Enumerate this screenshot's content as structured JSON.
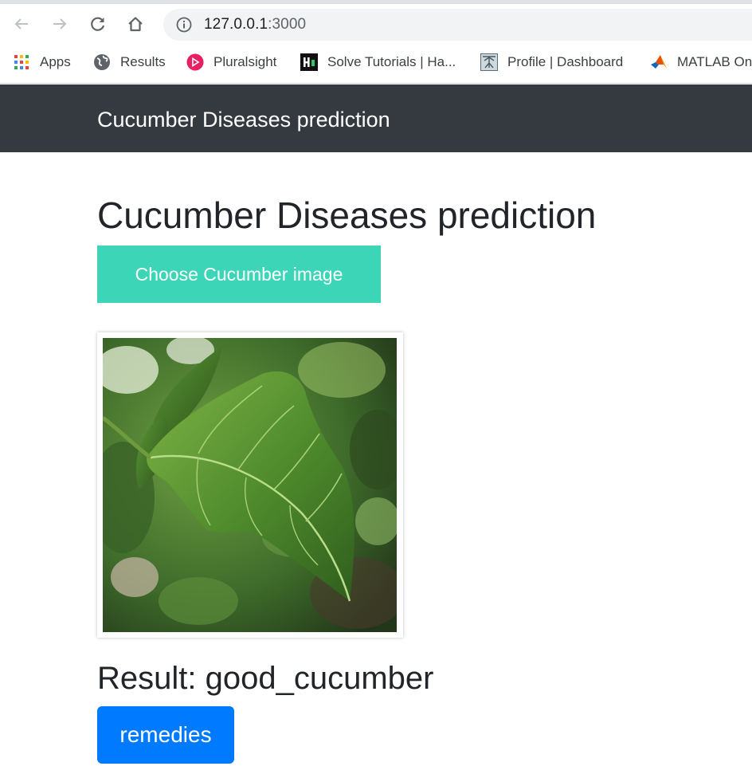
{
  "browser": {
    "url_host": "127.0.0.1",
    "url_port": ":3000",
    "bookmarks": [
      {
        "label": "Apps",
        "icon": "apps-grid-icon"
      },
      {
        "label": "Results",
        "icon": "globe-icon"
      },
      {
        "label": "Pluralsight",
        "icon": "pluralsight-icon"
      },
      {
        "label": "Solve Tutorials | Ha...",
        "icon": "hackerrank-icon"
      },
      {
        "label": "Profile | Dashboard",
        "icon": "profile-icon"
      },
      {
        "label": "MATLAB On",
        "icon": "matlab-icon"
      }
    ]
  },
  "navbar": {
    "brand": "Cucumber Diseases prediction"
  },
  "main": {
    "heading": "Cucumber Diseases prediction",
    "choose_button": "Choose Cucumber image",
    "image_subject": "leaf photo",
    "result_text": "Result: good_cucumber",
    "remedies_button": "remedies"
  },
  "colors": {
    "navbar_bg": "#343a40",
    "choose_button_bg": "#3dd5b8",
    "remedies_button_bg": "#007bff"
  }
}
